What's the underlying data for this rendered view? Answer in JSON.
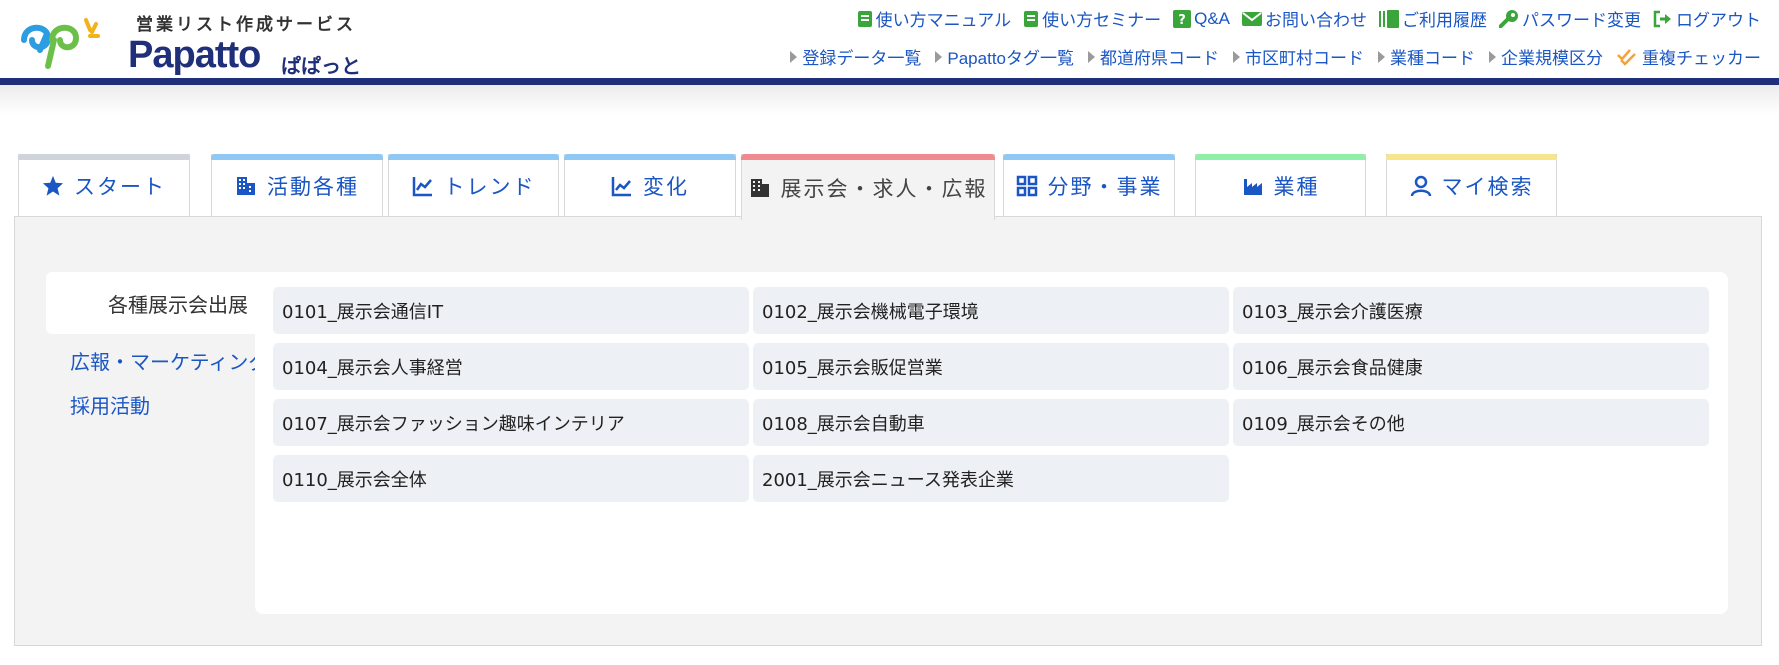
{
  "header": {
    "tagline": "営業リスト作成サービス",
    "brand": "Papatto",
    "brand_kana": "ぱぱっと",
    "links": [
      {
        "label": "使い方マニュアル",
        "icon": "book-icon"
      },
      {
        "label": "使い方セミナー",
        "icon": "book-icon"
      },
      {
        "label": "Q&A",
        "icon": "question-icon"
      },
      {
        "label": "お問い合わせ",
        "icon": "envelope-icon"
      },
      {
        "label": "ご利用履歴",
        "icon": "history-icon"
      },
      {
        "label": "パスワード変更",
        "icon": "key-icon"
      },
      {
        "label": "ログアウト",
        "icon": "logout-icon"
      }
    ],
    "subnav": [
      {
        "label": "登録データ一覧"
      },
      {
        "label": "Papattoタグ一覧"
      },
      {
        "label": "都道府県コード"
      },
      {
        "label": "市区町村コード"
      },
      {
        "label": "業種コード"
      },
      {
        "label": "企業規模区分"
      },
      {
        "label": "重複チェッカー",
        "icon": "double-check-icon"
      }
    ]
  },
  "tabs": [
    {
      "label": "スタート",
      "icon": "star-icon",
      "color": "#cfd4da"
    },
    {
      "label": "活動各種",
      "icon": "building-icon",
      "color": "#8fc8f5"
    },
    {
      "label": "トレンド",
      "icon": "trend-icon",
      "color": "#8fc8f5"
    },
    {
      "label": "変化",
      "icon": "chart-area-icon",
      "color": "#8fc8f5"
    },
    {
      "label": "展示会・求人・広報",
      "icon": "office-icon",
      "color": "#f08a8f",
      "active": true
    },
    {
      "label": "分野・事業",
      "icon": "grid-icon",
      "color": "#8fc8f5"
    },
    {
      "label": "業種",
      "icon": "industry-icon",
      "color": "#8eefa9"
    },
    {
      "label": "マイ検索",
      "icon": "user-icon",
      "color": "#f6e58a"
    }
  ],
  "sidebar": {
    "items": [
      {
        "label": "各種展示会出展",
        "active": true
      },
      {
        "label": "広報・マーケティング"
      },
      {
        "label": "採用活動"
      }
    ]
  },
  "categories": [
    "0101_展示会通信IT",
    "0102_展示会機械電子環境",
    "0103_展示会介護医療",
    "0104_展示会人事経営",
    "0105_展示会販促営業",
    "0106_展示会食品健康",
    "0107_展示会ファッション趣味インテリア",
    "0108_展示会自動車",
    "0109_展示会その他",
    "0110_展示会全体",
    "2001_展示会ニュース発表企業"
  ],
  "colors": {
    "accent": "#1a56c4",
    "header_bar": "#1f2f7a",
    "panel_bg": "#f3f3f3",
    "tile_bg": "#edf0f4"
  }
}
